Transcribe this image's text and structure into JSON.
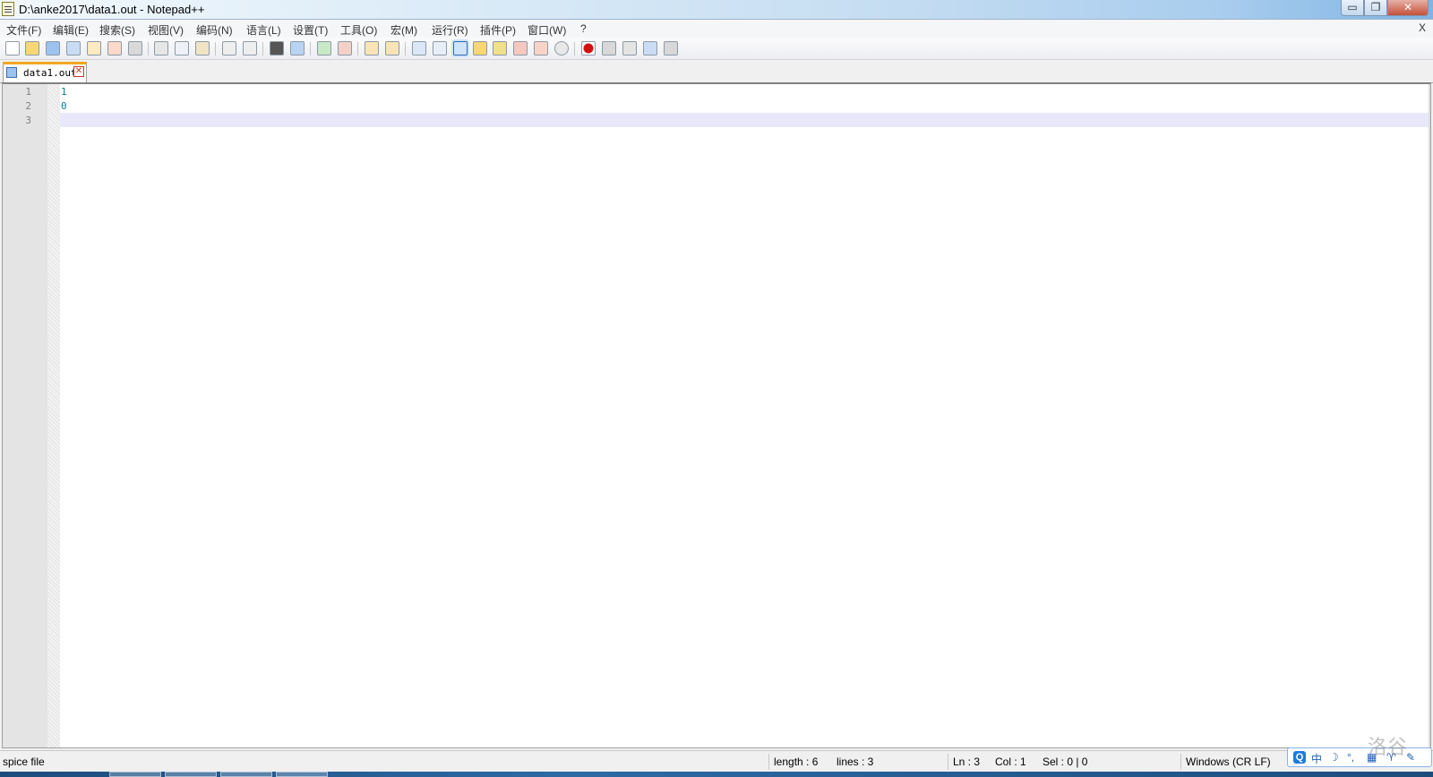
{
  "window": {
    "title": "D:\\anke2017\\data1.out - Notepad++",
    "minimize_glyph": "▭",
    "restore_glyph": "❐",
    "close_glyph": "✕"
  },
  "menu": {
    "items": [
      "文件(F)",
      "编辑(E)",
      "搜索(S)",
      "视图(V)",
      "编码(N)",
      "语言(L)",
      "设置(T)",
      "工具(O)",
      "宏(M)",
      "运行(R)",
      "插件(P)",
      "窗口(W)",
      "?"
    ],
    "close_doc": "X"
  },
  "toolbar": {
    "icons": [
      "new-file-icon",
      "open-file-icon",
      "save-icon",
      "save-all-icon",
      "close-icon",
      "close-all-icon",
      "print-icon",
      "cut-icon",
      "copy-icon",
      "paste-icon",
      "undo-icon",
      "redo-icon",
      "find-icon",
      "replace-icon",
      "zoom-in-icon",
      "zoom-out-icon",
      "sync-vertical-icon",
      "sync-horizontal-icon",
      "word-wrap-icon",
      "show-all-chars-icon",
      "indent-guide-icon",
      "user-language-icon",
      "doc-map-icon",
      "function-list-icon",
      "folder-as-workspace-icon",
      "monitoring-icon",
      "record-macro-icon",
      "stop-macro-icon",
      "play-macro-icon",
      "run-macro-multiple-icon",
      "save-macro-icon"
    ]
  },
  "tab": {
    "label": "data1.out",
    "close_glyph": "✕"
  },
  "editor": {
    "lines": [
      {
        "number": "1",
        "text": "1"
      },
      {
        "number": "2",
        "text": "0"
      },
      {
        "number": "3",
        "text": ""
      }
    ]
  },
  "status": {
    "file_type": "spice file",
    "length": "length : 6",
    "lines": "lines : 3",
    "ln": "Ln : 3",
    "col": "Col : 1",
    "sel": "Sel : 0 | 0",
    "eol": "Windows (CR LF)"
  },
  "ime": {
    "logo": "Q",
    "mode": "中",
    "moon": "☽",
    "punct": "°,",
    "keyboard": "▦",
    "skin": "♈",
    "tools": "✎"
  },
  "watermark": "洛谷",
  "colors": {
    "tab_accent": "#f5a623",
    "code_text": "#0a7c8c",
    "current_line": "#e8e8fa"
  }
}
